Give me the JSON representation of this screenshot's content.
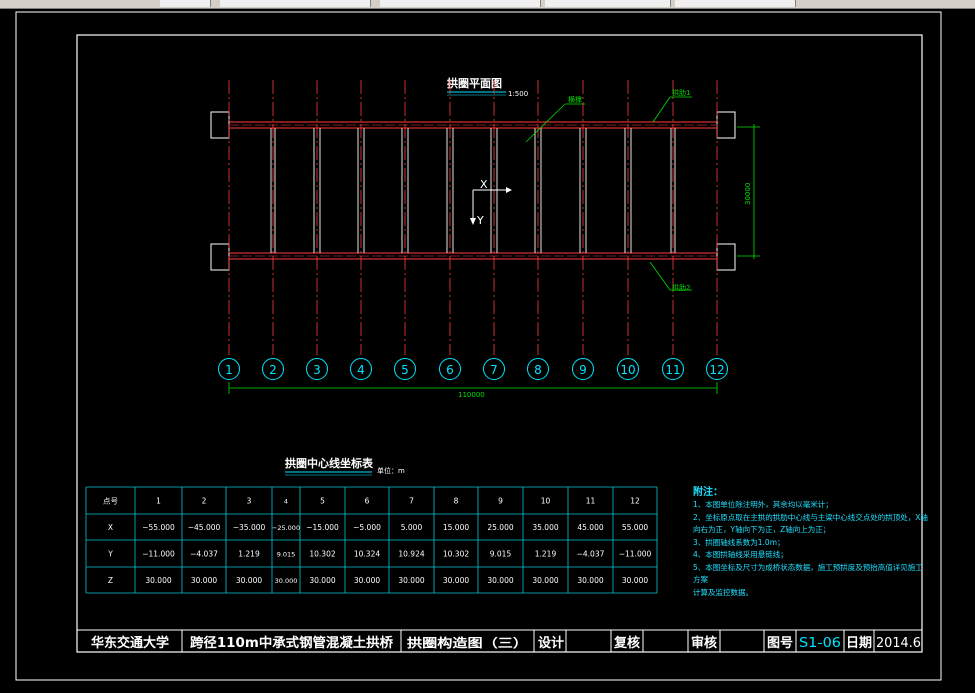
{
  "drawing": {
    "plan_title": "拱圈平面图",
    "plan_scale": "1:500",
    "label_brace": "横撑",
    "label_rib1": "拱肋1",
    "label_rib2": "拱肋2",
    "dim_width": "30000",
    "dim_span": "110000",
    "axis_x": "X",
    "axis_y": "Y",
    "gridlines": [
      "1",
      "2",
      "3",
      "4",
      "5",
      "6",
      "7",
      "8",
      "9",
      "10",
      "11",
      "12"
    ]
  },
  "table": {
    "title": "拱圈中心线坐标表",
    "unit": "单位：m",
    "header": [
      "点号",
      "1",
      "2",
      "3",
      "4",
      "5",
      "6",
      "7",
      "8",
      "9",
      "10",
      "11",
      "12"
    ],
    "rows": [
      [
        "X",
        "−55.000",
        "−45.000",
        "−35.000",
        "−25.000",
        "−15.000",
        "−5.000",
        "5.000",
        "15.000",
        "25.000",
        "35.000",
        "45.000",
        "55.000"
      ],
      [
        "Y",
        "−11.000",
        "−4.037",
        "1.219",
        "9.015",
        "10.302",
        "10.324",
        "10.924",
        "10.302",
        "9.015",
        "1.219",
        "−4.037",
        "−11.000"
      ],
      [
        "Z",
        "30.000",
        "30.000",
        "30.000",
        "30.000",
        "30.000",
        "30.000",
        "30.000",
        "30.000",
        "30.000",
        "30.000",
        "30.000",
        "30.000"
      ]
    ]
  },
  "notes": {
    "title": "附注：",
    "lines": [
      "1、本图单位除注明外，其余均以毫米计；",
      "2、坐标原点取在主拱的拱肋中心线与主梁中心线交点处的拱顶处，X轴",
      "   向右为正，Y轴向下为正，Z轴向上为正；",
      "3、拱圈轴线系数为1.0m；",
      "4、本图拱轴线采用悬链线；",
      "5、本图坐标及尺寸为成桥状态数据，施工预拱度及预抬高值详见施工方案",
      "   计算及监控数据。"
    ]
  },
  "title_block": {
    "school": "华东交通大学",
    "project": "跨径110m中承式钢管混凝土拱桥",
    "drawing_name": "拱圈构造图（三）",
    "design": "设计",
    "review": "复核",
    "approve": "审核",
    "drawing_no_label": "图号",
    "drawing_no": "S1-06",
    "date_label": "日期",
    "date": "2014.6"
  },
  "colors": {
    "background": "#000000",
    "frame": "#ffffff",
    "rib": "#ff3b3b",
    "dimension": "#00e000",
    "grid_bubble": "#00e5ff",
    "table_line": "#00c8d8",
    "drawing_no": "#00e5ff"
  }
}
